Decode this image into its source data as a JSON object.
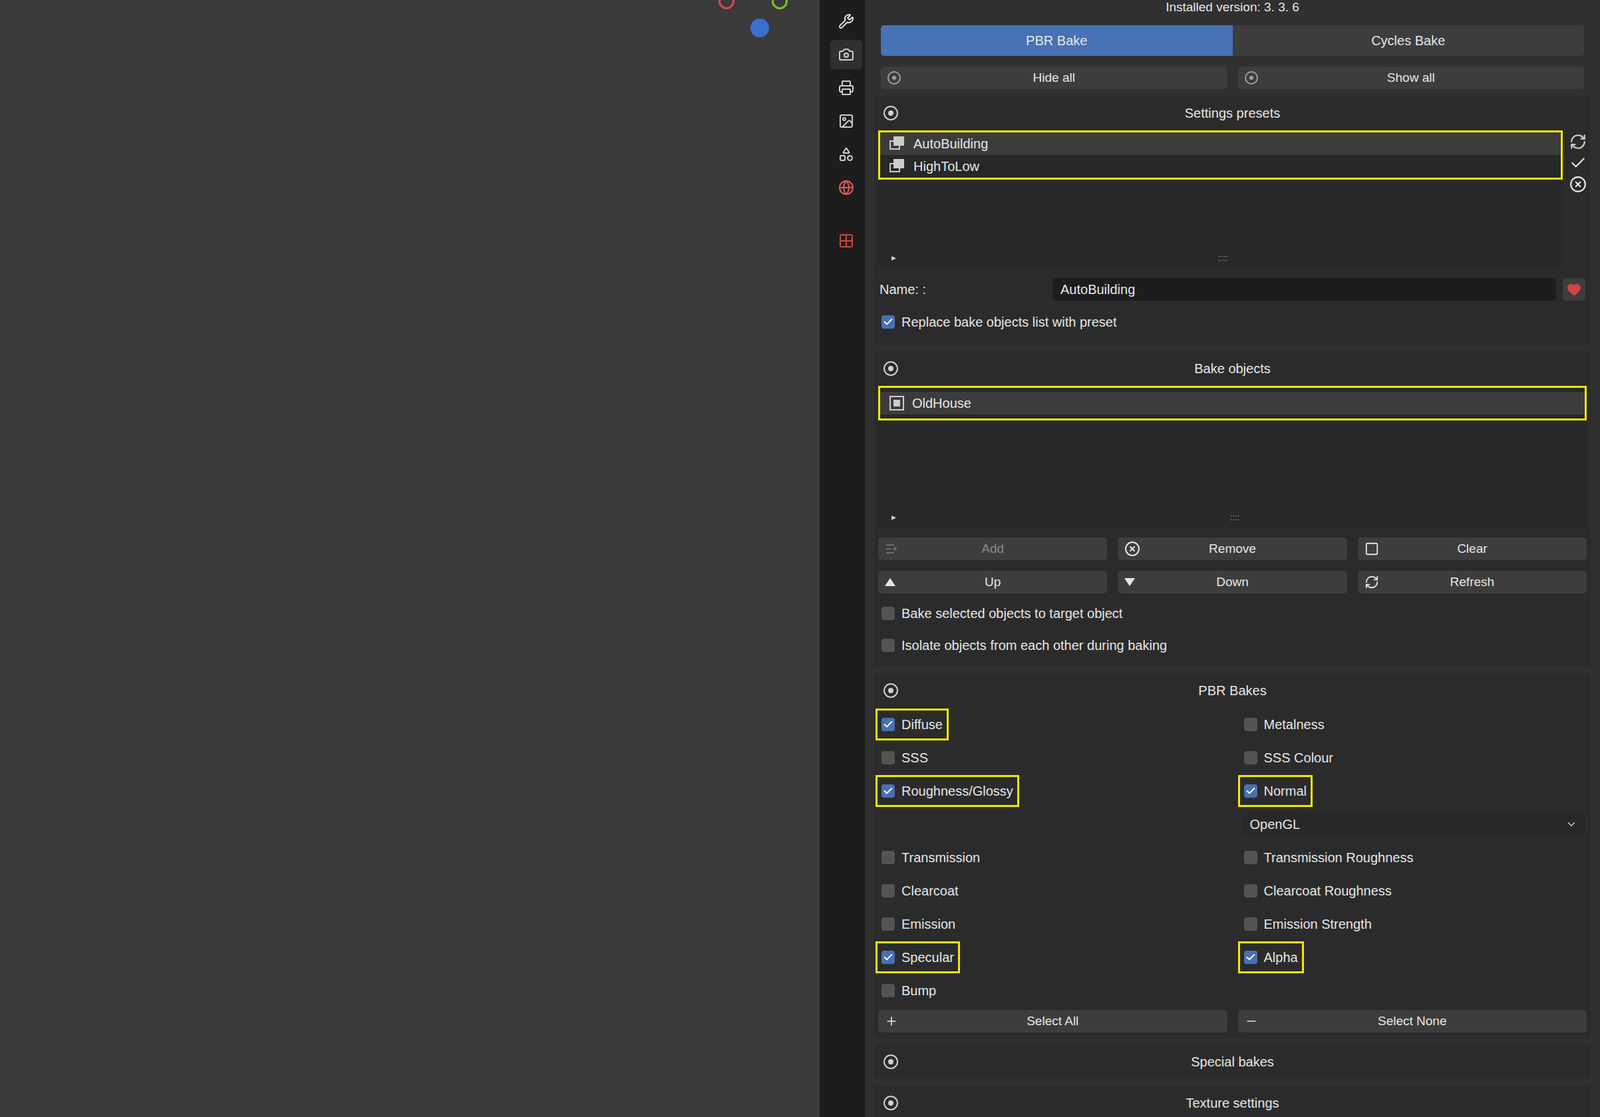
{
  "header": {
    "version": "Installed version: 3. 3. 6"
  },
  "propertyTabs": [
    {
      "selected": false
    },
    {
      "selected": true
    },
    {
      "selected": false
    },
    {
      "selected": false
    },
    {
      "selected": false
    },
    {
      "selected": false
    },
    {
      "selected": false
    }
  ],
  "modeTabs": [
    {
      "label": "PBR Bake",
      "selected": true
    },
    {
      "label": "Cycles Bake",
      "selected": false
    }
  ],
  "visibility": [
    {
      "label": "Hide all"
    },
    {
      "label": "Show all"
    }
  ],
  "presets": {
    "title": "Settings presets",
    "highlighted": true,
    "items": [
      {
        "label": "AutoBuilding",
        "selected": true
      },
      {
        "label": "HighToLow",
        "selected": false
      }
    ],
    "expander": "▸",
    "grip": "::::",
    "nameLabel": "Name: :",
    "nameValue": "AutoBuilding",
    "replace": {
      "label": "Replace bake objects list with preset",
      "checked": true
    }
  },
  "bakeObjects": {
    "title": "Bake objects",
    "highlighted": true,
    "items": [
      {
        "label": "OldHouse",
        "selected": true
      }
    ],
    "expander": "▸",
    "grip": "::::",
    "buttons": [
      {
        "label": "Add",
        "disabled": true
      },
      {
        "label": "Remove",
        "disabled": false
      },
      {
        "label": "Clear",
        "disabled": false
      },
      {
        "label": "Up",
        "disabled": false
      },
      {
        "label": "Down",
        "disabled": false
      },
      {
        "label": "Refresh",
        "disabled": false
      }
    ],
    "options": [
      {
        "label": "Bake selected objects to target object",
        "checked": false
      },
      {
        "label": "Isolate objects from each other during baking",
        "checked": false
      }
    ]
  },
  "pbrBakes": {
    "title": "PBR Bakes",
    "rows": [
      [
        {
          "kind": "checkbox",
          "label": "Diffuse",
          "checked": true,
          "highlighted": true
        },
        {
          "kind": "checkbox",
          "label": "Metalness",
          "checked": false,
          "highlighted": false
        }
      ],
      [
        {
          "kind": "checkbox",
          "label": "SSS",
          "checked": false,
          "highlighted": false
        },
        {
          "kind": "checkbox",
          "label": "SSS Colour",
          "checked": false,
          "highlighted": false
        }
      ],
      [
        {
          "kind": "checkbox",
          "label": "Roughness/Glossy",
          "checked": true,
          "highlighted": true
        },
        {
          "kind": "checkbox",
          "label": "Normal",
          "checked": true,
          "highlighted": true
        }
      ],
      [
        {
          "kind": "empty"
        },
        {
          "kind": "dropdown",
          "label": "OpenGL"
        }
      ],
      [
        {
          "kind": "checkbox",
          "label": "Transmission",
          "checked": false,
          "highlighted": false
        },
        {
          "kind": "checkbox",
          "label": "Transmission Roughness",
          "checked": false,
          "highlighted": false
        }
      ],
      [
        {
          "kind": "checkbox",
          "label": "Clearcoat",
          "checked": false,
          "highlighted": false
        },
        {
          "kind": "checkbox",
          "label": "Clearcoat Roughness",
          "checked": false,
          "highlighted": false
        }
      ],
      [
        {
          "kind": "checkbox",
          "label": "Emission",
          "checked": false,
          "highlighted": false
        },
        {
          "kind": "checkbox",
          "label": "Emission Strength",
          "checked": false,
          "highlighted": false
        }
      ],
      [
        {
          "kind": "checkbox",
          "label": "Specular",
          "checked": true,
          "highlighted": true
        },
        {
          "kind": "checkbox",
          "label": "Alpha",
          "checked": true,
          "highlighted": true
        }
      ],
      [
        {
          "kind": "checkbox",
          "label": "Bump",
          "checked": false,
          "highlighted": false
        },
        {
          "kind": "empty"
        }
      ]
    ],
    "buttons": [
      {
        "label": "Select All"
      },
      {
        "label": "Select None"
      }
    ]
  },
  "collapsed": [
    {
      "title": "Special bakes"
    },
    {
      "title": "Texture settings"
    }
  ]
}
